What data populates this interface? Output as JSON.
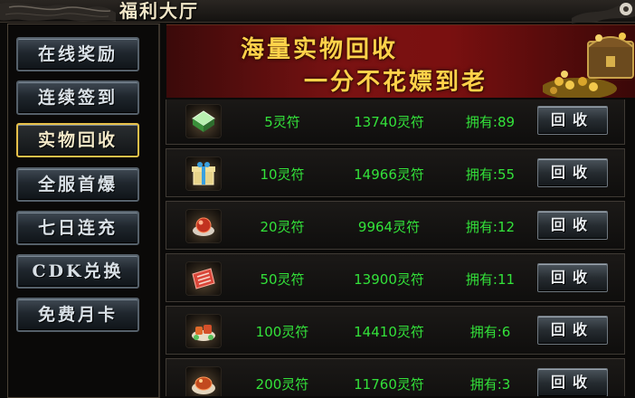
{
  "window": {
    "title": "福利大厅"
  },
  "sidebar": {
    "items": [
      {
        "label": "在线奖励"
      },
      {
        "label": "连续签到"
      },
      {
        "label": "实物回收",
        "active": true
      },
      {
        "label": "全服首爆"
      },
      {
        "label": "七日连充"
      },
      {
        "label": "CDK兑换"
      },
      {
        "label": "免费月卡"
      }
    ]
  },
  "banner": {
    "line1": "海量实物回收",
    "line2": "一分不花嫖到老"
  },
  "recycle_list": {
    "button_label": "回收",
    "rows": [
      {
        "icon": "green-jade-item-icon",
        "cost": "5灵符",
        "reward": "13740灵符",
        "owned": "拥有:89"
      },
      {
        "icon": "gift-box-item-icon",
        "cost": "10灵符",
        "reward": "14966灵符",
        "owned": "拥有:55"
      },
      {
        "icon": "red-orb-item-icon",
        "cost": "20灵符",
        "reward": "9964灵符",
        "owned": "拥有:12"
      },
      {
        "icon": "red-scroll-item-icon",
        "cost": "50灵符",
        "reward": "13900灵符",
        "owned": "拥有:11"
      },
      {
        "icon": "food-platter-item-icon",
        "cost": "100灵符",
        "reward": "14410灵符",
        "owned": "拥有:6"
      },
      {
        "icon": "roast-dish-item-icon",
        "cost": "200灵符",
        "reward": "11760灵符",
        "owned": "拥有:3"
      }
    ]
  },
  "colors": {
    "value_green": "#33e23a",
    "banner_gold": "#ffd24a",
    "active_border": "#e6c04a"
  }
}
